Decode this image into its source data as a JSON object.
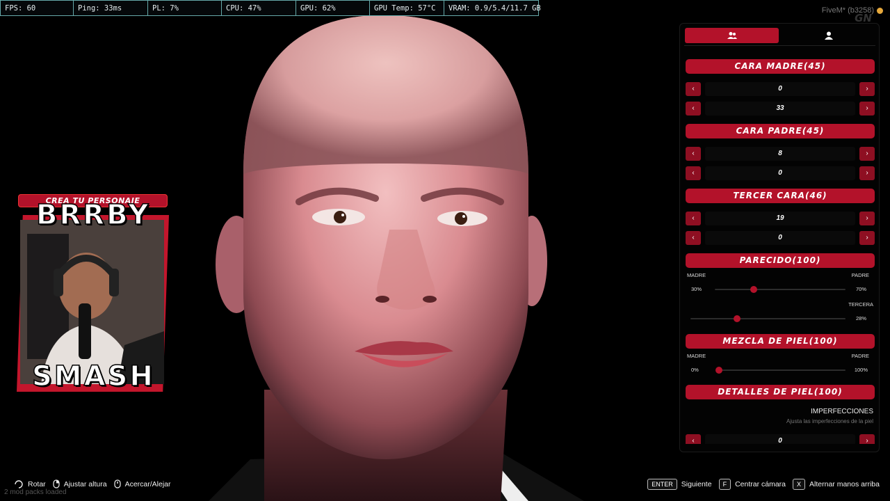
{
  "perf_bar": [
    "FPS: 60",
    "Ping: 33ms",
    "PL: 7%",
    "CPU: 47%",
    "GPU: 62%",
    "GPU Temp: 57°C",
    "VRAM: 0.9/5.4/11.7 GB"
  ],
  "watermark": {
    "client": "FiveM* (b3258)",
    "logo": "GN"
  },
  "webcam": {
    "banner": "CREA TU PERSONAJE",
    "name_top": "BRRBY",
    "name_bottom": "SMASH"
  },
  "mod_note": "2 mod packs loaded",
  "panel": {
    "tabs": [
      {
        "icon": "group-icon",
        "active": true
      },
      {
        "icon": "user-icon",
        "active": false
      }
    ],
    "cara_madre": {
      "title": "CARA MADRE(45)",
      "values": [
        "0",
        "33"
      ]
    },
    "cara_padre": {
      "title": "CARA PADRE(45)",
      "values": [
        "8",
        "0"
      ]
    },
    "tercer_cara": {
      "title": "TERCER CARA(46)",
      "values": [
        "19",
        "0"
      ]
    },
    "parecido": {
      "title": "PARECIDO(100)",
      "left_label": "MADRE",
      "right_label": "PADRE",
      "left_pct": "30%",
      "right_pct": "70%",
      "slider_value": 0.3,
      "third_label": "TERCERA",
      "third_pct": "28%",
      "third_value": 0.3
    },
    "mezcla_piel": {
      "title": "MEZCLA DE PIEL(100)",
      "left_label": "MADRE",
      "right_label": "PADRE",
      "left_pct": "0%",
      "right_pct": "100%",
      "slider_value": 0.0
    },
    "detalles_piel": {
      "title": "DETALLES DE PIEL(100)",
      "sub_title": "IMPERFECCIONES",
      "sub_desc": "Ajusta las imperfecciones de la piel",
      "value": "0"
    },
    "accent_color": "#b3122a"
  },
  "hints_left": [
    {
      "icon": "mouse-left-icon",
      "label": "Rotar"
    },
    {
      "icon": "mouse-right-icon",
      "label": "Ajustar altura"
    },
    {
      "icon": "scroll-wheel-icon",
      "label": "Acercar/Alejar"
    }
  ],
  "hints_right": [
    {
      "key": "ENTER",
      "label": "Siguiente"
    },
    {
      "key": "F",
      "label": "Centrar cámara"
    },
    {
      "key": "X",
      "label": "Alternar manos arriba"
    }
  ]
}
